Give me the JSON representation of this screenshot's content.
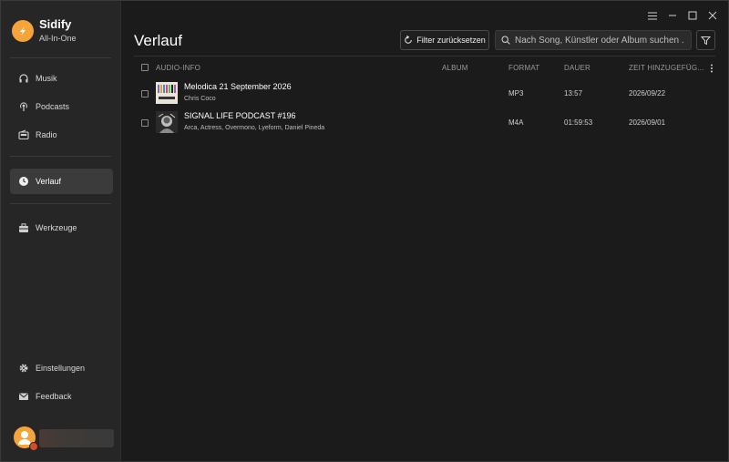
{
  "brand": {
    "name": "Sidify",
    "subtitle": "All-In-One"
  },
  "sidebar": {
    "items": [
      {
        "label": "Musik",
        "icon": "headphones-icon"
      },
      {
        "label": "Podcasts",
        "icon": "podcast-icon"
      },
      {
        "label": "Radio",
        "icon": "radio-icon"
      },
      {
        "label": "Verlauf",
        "icon": "clock-icon",
        "active": true
      },
      {
        "label": "Werkzeuge",
        "icon": "toolbox-icon"
      },
      {
        "label": "Einstellungen",
        "icon": "gear-icon"
      },
      {
        "label": "Feedback",
        "icon": "mail-icon"
      }
    ]
  },
  "header": {
    "title": "Verlauf",
    "filter_reset_label": "Filter zurücksetzen",
    "search_placeholder": "Nach Song, Künstler oder Album suchen ..."
  },
  "table": {
    "columns": [
      "AUDIO-INFO",
      "ALBUM",
      "FORMAT",
      "DAUER",
      "ZEIT HINZUGEFÜG..."
    ],
    "rows": [
      {
        "title": "Melodica 21 September 2026",
        "artist": "Chris Coco",
        "album": "",
        "format": "MP3",
        "duration": "13:57",
        "added": "2026/09/22"
      },
      {
        "title": "SIGNAL LIFE PODCAST #196",
        "artist": "Arca, Actress, Overmono, Lyeform, Daniel Pineda",
        "album": "",
        "format": "M4A",
        "duration": "01:59:53",
        "added": "2026/09/01"
      }
    ]
  },
  "colors": {
    "accent": "#f5a43a",
    "badge": "#d84a2a",
    "background": "#1b1b1b",
    "sidebar": "#262626"
  }
}
